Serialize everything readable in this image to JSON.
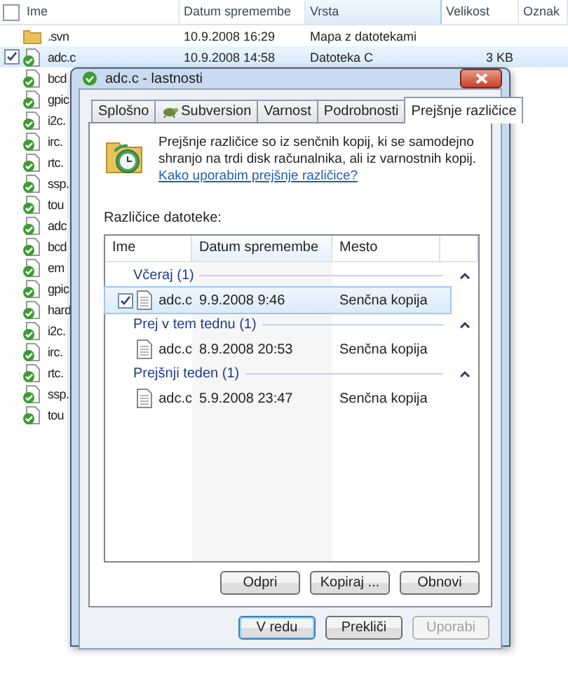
{
  "explorer": {
    "select_all": {
      "checked": false
    },
    "columns": [
      {
        "label": "Ime",
        "highlighted": false
      },
      {
        "label": "Datum spremembe",
        "highlighted": false
      },
      {
        "label": "Vrsta",
        "highlighted": true
      },
      {
        "label": "Velikost",
        "highlighted": false
      },
      {
        "label": "Oznak",
        "highlighted": false
      }
    ],
    "rows": [
      {
        "kind": "folder",
        "name": ".svn",
        "date": "10.9.2008 16:29",
        "type": "Mapa z datotekami",
        "checked": false,
        "selected": false
      },
      {
        "kind": "file",
        "name": "adc.c",
        "date": "10.9.2008 14:58",
        "type": "Datoteka C",
        "size": "3 KB",
        "checked": true,
        "selected": true
      },
      {
        "kind": "file",
        "name": "bcd",
        "checked": false,
        "selected": false
      },
      {
        "kind": "file",
        "name": "gpic",
        "checked": false,
        "selected": false
      },
      {
        "kind": "file",
        "name": "i2c.",
        "checked": false,
        "selected": false
      },
      {
        "kind": "file",
        "name": "irc.",
        "checked": false,
        "selected": false
      },
      {
        "kind": "file",
        "name": "rtc.",
        "checked": false,
        "selected": false
      },
      {
        "kind": "file",
        "name": "ssp.",
        "checked": false,
        "selected": false
      },
      {
        "kind": "file",
        "name": "tou",
        "checked": false,
        "selected": false
      },
      {
        "kind": "file",
        "name": "adc",
        "checked": false,
        "selected": false
      },
      {
        "kind": "file",
        "name": "bcd",
        "checked": false,
        "selected": false
      },
      {
        "kind": "file",
        "name": "em",
        "checked": false,
        "selected": false
      },
      {
        "kind": "file",
        "name": "gpic",
        "checked": false,
        "selected": false
      },
      {
        "kind": "file",
        "name": "hard",
        "checked": false,
        "selected": false
      },
      {
        "kind": "file",
        "name": "i2c.",
        "checked": false,
        "selected": false
      },
      {
        "kind": "file",
        "name": "irc.",
        "checked": false,
        "selected": false
      },
      {
        "kind": "file",
        "name": "rtc.",
        "checked": false,
        "selected": false
      },
      {
        "kind": "file",
        "name": "ssp.",
        "checked": false,
        "selected": false
      },
      {
        "kind": "file",
        "name": "tou",
        "checked": false,
        "selected": false
      }
    ]
  },
  "dialog": {
    "title": "adc.c - lastnosti",
    "tabs": [
      {
        "label": "Splošno",
        "selected": false
      },
      {
        "label": "Subversion",
        "selected": false,
        "icon": true
      },
      {
        "label": "Varnost",
        "selected": false
      },
      {
        "label": "Podrobnosti",
        "selected": false
      },
      {
        "label": "Prejšnje različice",
        "selected": true
      }
    ],
    "description": "Prejšnje različice so iz senčnih kopij, ki se samodejno shranjo na trdi disk računalnika, ali iz varnostnih kopij.",
    "help_link": "Kako uporabim prejšnje različice?",
    "versions_label": "Različice datoteke:",
    "versions": {
      "columns": [
        {
          "label": "Ime",
          "sorted": false
        },
        {
          "label": "Datum spremembe",
          "sorted": true
        },
        {
          "label": "Mesto",
          "sorted": false
        }
      ],
      "groups": [
        {
          "label": "Včeraj (1)",
          "expanded": true,
          "items": [
            {
              "name": "adc.c",
              "date": "9.9.2008 9:46",
              "location": "Senčna kopija",
              "checked": true,
              "selected": true
            }
          ]
        },
        {
          "label": "Prej v tem tednu (1)",
          "expanded": true,
          "items": [
            {
              "name": "adc.c",
              "date": "8.9.2008 20:53",
              "location": "Senčna kopija",
              "checked": false,
              "selected": false
            }
          ]
        },
        {
          "label": "Prejšnji teden (1)",
          "expanded": true,
          "items": [
            {
              "name": "adc.c",
              "date": "5.9.2008 23:47",
              "location": "Senčna kopija",
              "checked": false,
              "selected": false
            }
          ]
        }
      ]
    },
    "actions": [
      {
        "label": "Odpri",
        "disabled": false
      },
      {
        "label": "Kopiraj ...",
        "disabled": false
      },
      {
        "label": "Obnovi",
        "disabled": false
      }
    ],
    "buttons": [
      {
        "label": "V redu",
        "default": true,
        "disabled": false
      },
      {
        "label": "Prekliči",
        "default": false,
        "disabled": false
      },
      {
        "label": "Uporabi",
        "default": false,
        "disabled": true
      }
    ]
  }
}
